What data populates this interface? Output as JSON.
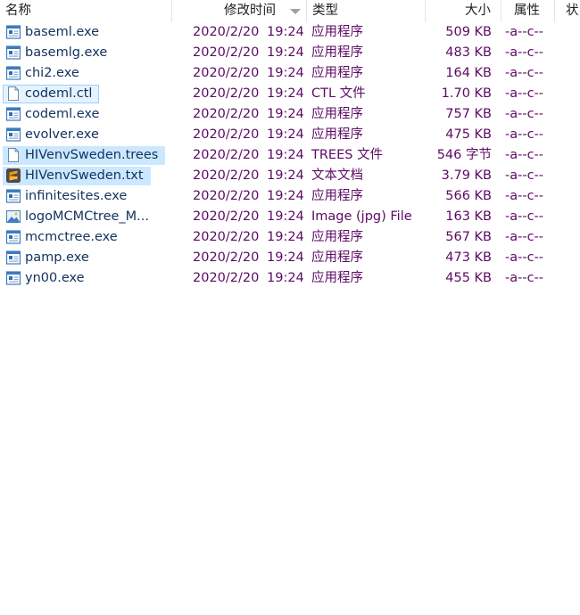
{
  "columns": {
    "name": "名称",
    "date": "修改时间",
    "type": "类型",
    "size": "大小",
    "attr": "属性",
    "state": "状"
  },
  "files": [
    {
      "name": "baseml.exe",
      "date": "2020/2/20",
      "time": "19:24",
      "type": "应用程序",
      "size": "509 KB",
      "attr": "-a--c--",
      "icon": "exe-icon",
      "state": ""
    },
    {
      "name": "basemlg.exe",
      "date": "2020/2/20",
      "time": "19:24",
      "type": "应用程序",
      "size": "483 KB",
      "attr": "-a--c--",
      "icon": "exe-icon",
      "state": ""
    },
    {
      "name": "chi2.exe",
      "date": "2020/2/20",
      "time": "19:24",
      "type": "应用程序",
      "size": "164 KB",
      "attr": "-a--c--",
      "icon": "exe-icon",
      "state": ""
    },
    {
      "name": "codeml.ctl",
      "date": "2020/2/20",
      "time": "19:24",
      "type": "CTL 文件",
      "size": "1.70 KB",
      "attr": "-a--c--",
      "icon": "file-icon",
      "state": "outlined"
    },
    {
      "name": "codeml.exe",
      "date": "2020/2/20",
      "time": "19:24",
      "type": "应用程序",
      "size": "757 KB",
      "attr": "-a--c--",
      "icon": "exe-icon",
      "state": ""
    },
    {
      "name": "evolver.exe",
      "date": "2020/2/20",
      "time": "19:24",
      "type": "应用程序",
      "size": "475 KB",
      "attr": "-a--c--",
      "icon": "exe-icon",
      "state": ""
    },
    {
      "name": "HIVenvSweden.trees",
      "date": "2020/2/20",
      "time": "19:24",
      "type": "TREES 文件",
      "size": "546 字节",
      "attr": "-a--c--",
      "icon": "file-icon",
      "state": "selected"
    },
    {
      "name": "HIVenvSweden.txt",
      "date": "2020/2/20",
      "time": "19:24",
      "type": "文本文档",
      "size": "3.79 KB",
      "attr": "-a--c--",
      "icon": "sublime-text-icon",
      "state": "selected"
    },
    {
      "name": "infinitesites.exe",
      "date": "2020/2/20",
      "time": "19:24",
      "type": "应用程序",
      "size": "566 KB",
      "attr": "-a--c--",
      "icon": "exe-icon",
      "state": ""
    },
    {
      "name": "logoMCMCtree_M...",
      "date": "2020/2/20",
      "time": "19:24",
      "type": "Image (jpg) File",
      "size": "163 KB",
      "attr": "-a--c--",
      "icon": "image-icon",
      "state": ""
    },
    {
      "name": "mcmctree.exe",
      "date": "2020/2/20",
      "time": "19:24",
      "type": "应用程序",
      "size": "567 KB",
      "attr": "-a--c--",
      "icon": "exe-icon",
      "state": ""
    },
    {
      "name": "pamp.exe",
      "date": "2020/2/20",
      "time": "19:24",
      "type": "应用程序",
      "size": "473 KB",
      "attr": "-a--c--",
      "icon": "exe-icon",
      "state": ""
    },
    {
      "name": "yn00.exe",
      "date": "2020/2/20",
      "time": "19:24",
      "type": "应用程序",
      "size": "455 KB",
      "attr": "-a--c--",
      "icon": "exe-icon",
      "state": ""
    }
  ],
  "colors": {
    "selection": "#cce8ff",
    "focus_outline": "#99d1ff",
    "detail_text": "#5c0a64",
    "name_text": "#12315e"
  }
}
